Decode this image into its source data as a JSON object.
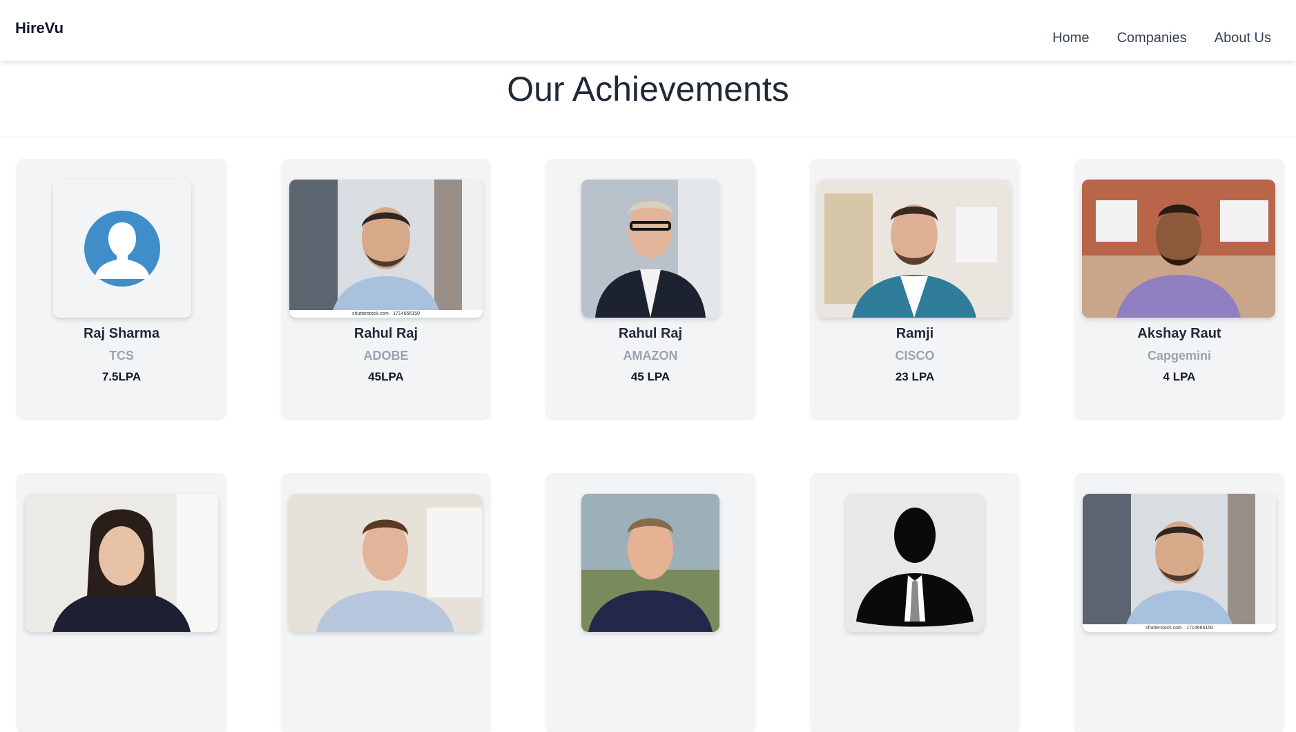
{
  "brand": "HireVu",
  "nav": {
    "home": "Home",
    "companies": "Companies",
    "about": "About Us"
  },
  "title": "Our Achievements",
  "photo_watermark": "shutterstock.com · 1714666150",
  "achievements": [
    {
      "name": "Raj Sharma",
      "company": "TCS",
      "package": "7.5LPA",
      "photo": "default-avatar-icon"
    },
    {
      "name": "Rahul Raj",
      "company": "ADOBE",
      "package": "45LPA",
      "photo": "man-glasses-photo"
    },
    {
      "name": "Rahul Raj",
      "company": "AMAZON",
      "package": "45 LPA",
      "photo": "man-suit-photo"
    },
    {
      "name": "Ramji",
      "company": "CISCO",
      "package": "23 LPA",
      "photo": "man-teal-shirt-photo"
    },
    {
      "name": "Akshay Raut",
      "company": "Capgemini",
      "package": "4 LPA",
      "photo": "man-purple-shirt-photo"
    },
    {
      "photo": "woman-smiling-photo"
    },
    {
      "photo": "man-light-shirt-photo"
    },
    {
      "photo": "man-sweater-photo"
    },
    {
      "photo": "silhouette-suit-icon"
    },
    {
      "photo": "man-glasses-photo"
    }
  ],
  "colors": {
    "card_bg": "#f3f4f6",
    "company_text": "#9ca3af",
    "avatar_blue": "#3f8ec9"
  }
}
